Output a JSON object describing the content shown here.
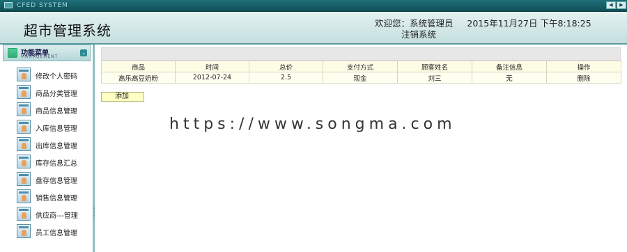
{
  "system_bar": {
    "title": "CFED SYSTEM",
    "prev_glyph": "◀",
    "next_glyph": "▶"
  },
  "header": {
    "app_title": "超市管理系统",
    "welcome_text": "欢迎您：系统管理员",
    "datetime": "2015年11月27日 下午8:18:25",
    "logout_label": "注销系统"
  },
  "sidebar": {
    "menu_title": "功能菜单",
    "menu_subtitle": "MANAGEMENT",
    "collapse_glyph": "⌄",
    "items": [
      {
        "label": "修改个人密码",
        "icon": "user-card-icon"
      },
      {
        "label": "商品分类管理",
        "icon": "user-card-icon"
      },
      {
        "label": "商品信息管理",
        "icon": "user-card-icon"
      },
      {
        "label": "入库信息管理",
        "icon": "user-card-icon"
      },
      {
        "label": "出库信息管理",
        "icon": "user-card-icon"
      },
      {
        "label": "库存信息汇总",
        "icon": "user-card-icon"
      },
      {
        "label": "盘存信息管理",
        "icon": "user-card-icon"
      },
      {
        "label": "销售信息管理",
        "icon": "user-card-icon"
      },
      {
        "label": "供应商---管理",
        "icon": "user-card-icon"
      },
      {
        "label": "员工信息管理",
        "icon": "user-card-icon"
      }
    ]
  },
  "table": {
    "columns": [
      "商品",
      "时间",
      "总价",
      "支付方式",
      "顾客姓名",
      "备注信息",
      "操作"
    ],
    "rows": [
      {
        "product": "高乐高豆奶粉",
        "time": "2012-07-24",
        "total": "2.5",
        "payment": "现金",
        "customer": "刘三",
        "note": "无",
        "action": "删除"
      }
    ]
  },
  "add_label": "添加",
  "watermark": "https://www.songma.com"
}
